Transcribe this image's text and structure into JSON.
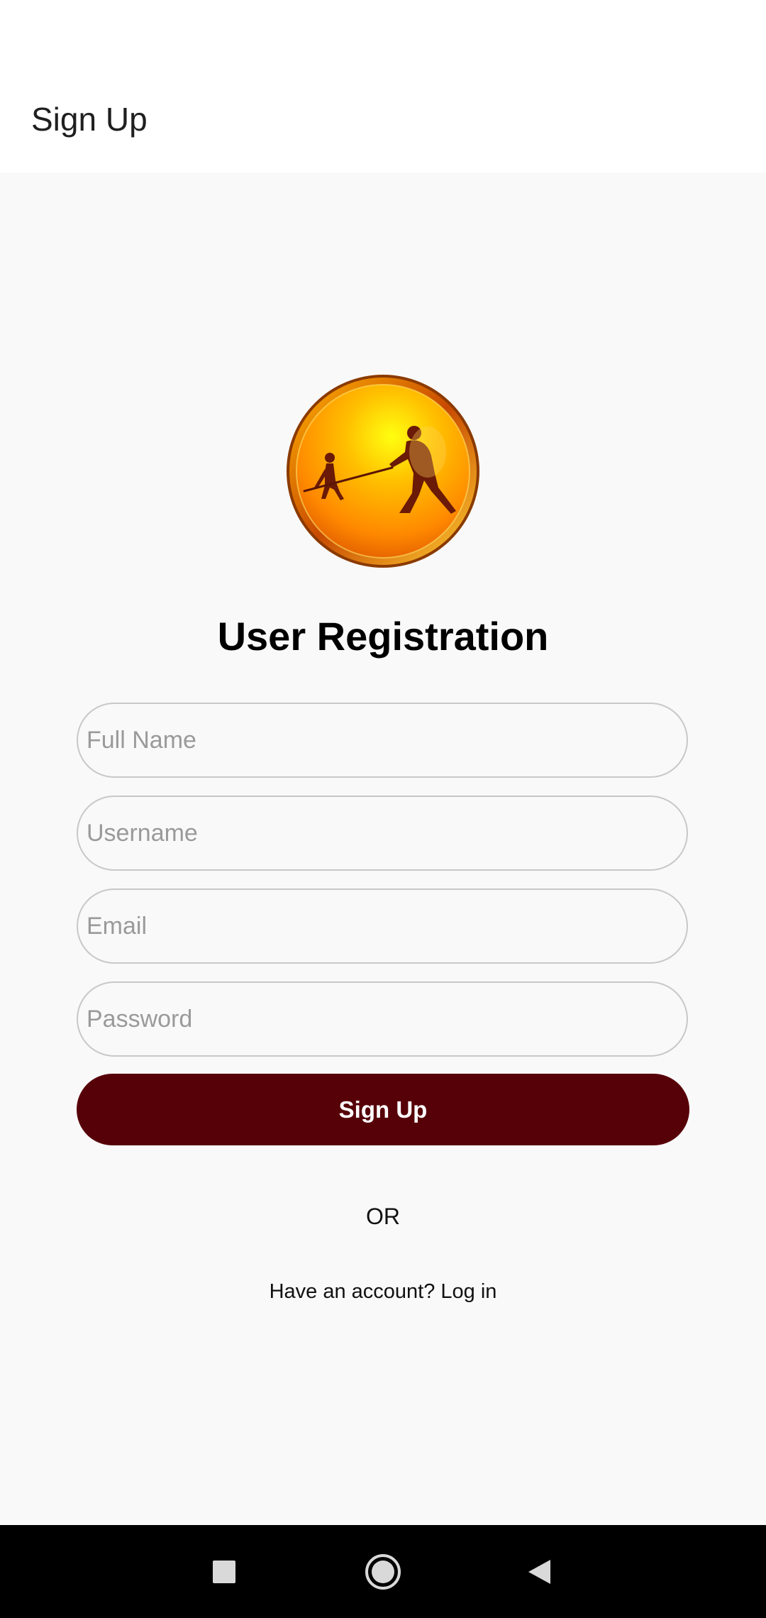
{
  "app_bar": {
    "title": "Sign Up"
  },
  "logo": {
    "icon": "gold-coin-emblem-icon"
  },
  "form": {
    "heading": "User Registration",
    "full_name_placeholder": "Full Name",
    "username_placeholder": "Username",
    "email_placeholder": "Email",
    "password_placeholder": "Password",
    "submit_label": "Sign Up"
  },
  "separator": "OR",
  "login_prompt": "Have an account? Log in",
  "nav_bar": {
    "recent_icon": "square-recents-icon",
    "home_icon": "circle-home-icon",
    "back_icon": "triangle-back-icon"
  },
  "colors": {
    "primary_button": "#560008",
    "app_bar_background": "#ffffff",
    "page_background": "#f9f9f9",
    "nav_bar_background": "#000000",
    "field_border": "#c8c8c8"
  }
}
